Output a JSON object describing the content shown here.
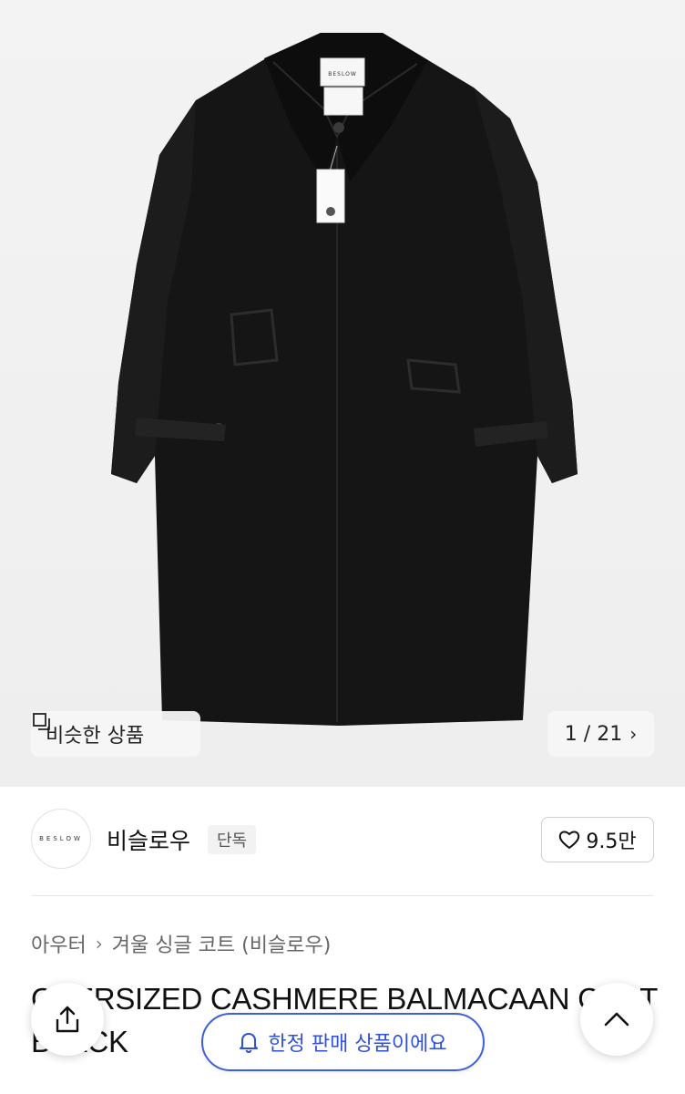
{
  "hero": {
    "similar_label": "비슷한 상품",
    "counter": "1 / 21",
    "coat_brand_tag": "BESLOW"
  },
  "brand": {
    "logo_text": "BESLOW",
    "name": "비슬로우",
    "badge": "단독",
    "likes": "9.5만"
  },
  "breadcrumb": {
    "category": "아우터",
    "subcategory": "겨울 싱글 코트 (비슬로우)"
  },
  "product": {
    "title": "OVERSIZED CASHMERE BALMACAAN COAT BLACK"
  },
  "limited_pill": {
    "label": "한정 판매 상품이에요"
  },
  "colors": {
    "accent": "#3b5fe0",
    "coat": "#111111",
    "hero_bg": "#f1f1f1"
  },
  "icons": {
    "similar": "copy-squares-icon",
    "chevron": "chevron-right-icon",
    "heart": "heart-icon",
    "share": "share-icon",
    "bell": "bell-icon",
    "up": "chevron-up-icon"
  }
}
